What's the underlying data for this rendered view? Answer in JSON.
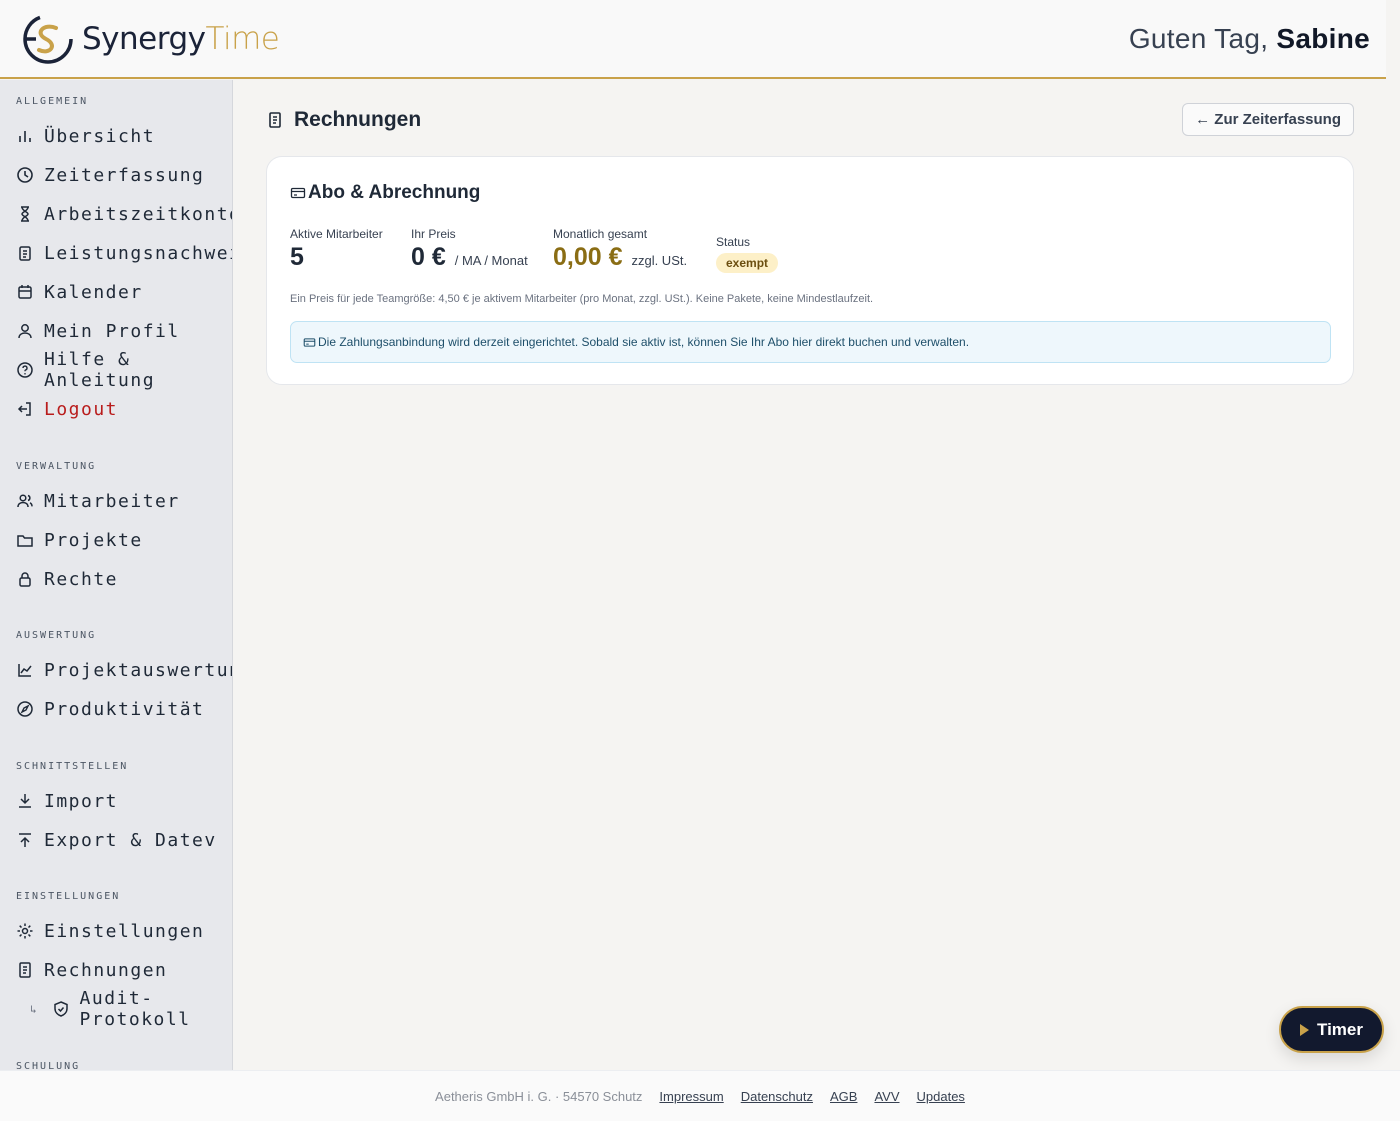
{
  "header": {
    "brand_part1": "Synergy",
    "brand_part2": "Time",
    "greeting_prefix": "Guten Tag,",
    "user_name": "Sabine"
  },
  "sidebar": {
    "sections": {
      "allgemein": "ALLGEMEIN",
      "verwaltung": "VERWALTUNG",
      "auswertung": "AUSWERTUNG",
      "schnittstellen": "SCHNITTSTELLEN",
      "einstellungen": "EINSTELLUNGEN",
      "schulung": "SCHULUNG"
    },
    "items": {
      "uebersicht": "Übersicht",
      "zeiterfassung": "Zeiterfassung",
      "arbeitszeitkonto": "Arbeitszeitkonto",
      "leistungsnachweis": "Leistungsnachweis",
      "kalender": "Kalender",
      "mein_profil": "Mein Profil",
      "hilfe": "Hilfe & Anleitung",
      "logout": "Logout",
      "mitarbeiter": "Mitarbeiter",
      "projekte": "Projekte",
      "rechte": "Rechte",
      "projektauswertung": "Projektauswertung",
      "produktivitaet": "Produktivität",
      "import": "Import",
      "export": "Export & Datev",
      "einstellungen": "Einstellungen",
      "rechnungen": "Rechnungen",
      "audit": "Audit-Protokoll"
    },
    "sub_arrow": "↳"
  },
  "main": {
    "title": "Rechnungen",
    "back_button": "← Zur Zeiterfassung",
    "card": {
      "title": "Abo & Abrechnung",
      "stats": {
        "employees_label": "Aktive Mitarbeiter",
        "employees_value": "5",
        "price_label": "Ihr Preis",
        "price_value": "0 €",
        "price_unit": "/ MA / Monat",
        "monthly_label": "Monatlich gesamt",
        "monthly_value": "0,00 €",
        "monthly_unit": "zzgl. USt.",
        "status_label": "Status",
        "status_value": "exempt"
      },
      "note": "Ein Preis für jede Teamgröße: 4,50 € je aktivem Mitarbeiter (pro Monat, zzgl. USt.). Keine Pakete, keine Mindestlaufzeit.",
      "info": "Die Zahlungsanbindung wird derzeit eingerichtet. Sobald sie aktiv ist, können Sie Ihr Abo hier direkt buchen und verwalten."
    }
  },
  "timer": {
    "label": "Timer"
  },
  "footer": {
    "company": "Aetheris GmbH i. G. · 54570 Schutz",
    "links": [
      "Impressum",
      "Datenschutz",
      "AGB",
      "AVV",
      "Updates"
    ]
  },
  "colors": {
    "accent": "#c9a24a",
    "navy": "#12192e",
    "logout": "#b91c1c"
  }
}
